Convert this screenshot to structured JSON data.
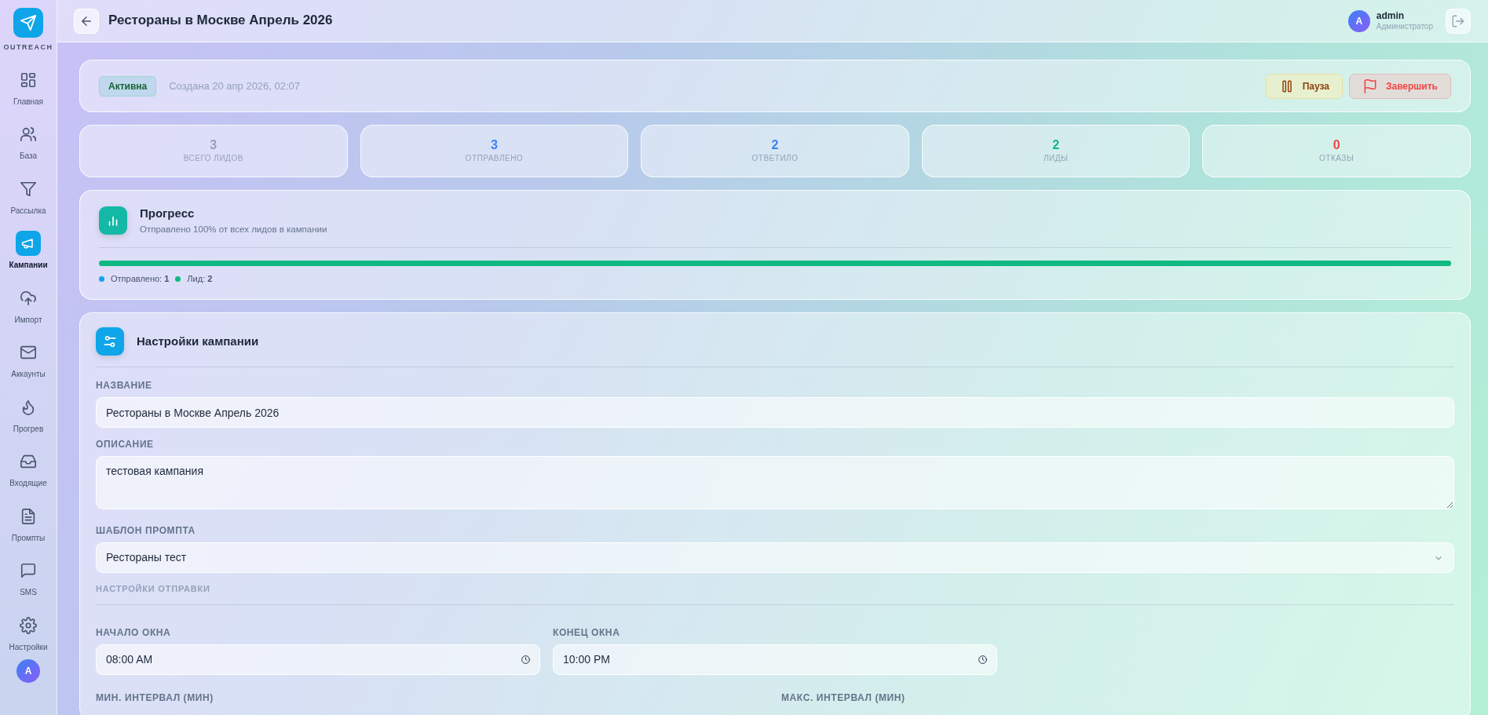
{
  "sidebar": {
    "logo": "OUTREACH",
    "items": [
      {
        "label": "Главная",
        "selected": false
      },
      {
        "label": "База",
        "selected": false
      },
      {
        "label": "Рассылка",
        "selected": false
      },
      {
        "label": "Кампании",
        "selected": true
      },
      {
        "label": "Импорт",
        "selected": false
      },
      {
        "label": "Аккаунты",
        "selected": false
      },
      {
        "label": "Прогрев",
        "selected": false
      },
      {
        "label": "Входящие",
        "selected": false
      },
      {
        "label": "Промпты",
        "selected": false
      },
      {
        "label": "SMS",
        "selected": false
      },
      {
        "label": "Настройки",
        "selected": false
      }
    ],
    "avatar": "A"
  },
  "header": {
    "title": "Рестораны в Москве Апрель 2026",
    "user": {
      "initial": "A",
      "name": "admin",
      "role": "Администратор"
    }
  },
  "status": {
    "badge": "Активна",
    "created": "Создана 20 апр 2026, 02:07",
    "buttons": [
      {
        "kind": "pause",
        "label": "Пауза"
      },
      {
        "kind": "finish",
        "label": "Завершить"
      }
    ]
  },
  "stats": [
    {
      "value": "3",
      "label": "ВСЕГО ЛИДОВ",
      "color": "#94a3b8"
    },
    {
      "value": "3",
      "label": "ОТПРАВЛЕНО",
      "color": "#3b82f6"
    },
    {
      "value": "2",
      "label": "ОТВЕТИЛО",
      "color": "#3b82f6"
    },
    {
      "value": "2",
      "label": "ЛИДЫ",
      "color": "#10b981"
    },
    {
      "value": "0",
      "label": "ОТКАЗЫ",
      "color": "#ef4444"
    }
  ],
  "progress": {
    "title": "Прогресс",
    "subtitle": "Отправлено 100% от всех лидов в кампании",
    "level": 1,
    "legend": [
      {
        "label": "Отправлено:",
        "value": "1",
        "color": "#0ea5e9"
      },
      {
        "label": "Лид:",
        "value": "2",
        "color": "#10b981"
      }
    ]
  },
  "settings": {
    "title": "Настройки кампании",
    "fields": [
      {
        "kind": "input",
        "label": "НАЗВАНИЕ",
        "value": "Рестораны в Москве Апрель 2026"
      },
      {
        "kind": "textarea",
        "label": "ОПИСАНИЕ",
        "value": "тестовая кампания"
      },
      {
        "kind": "select",
        "label": "ШАБЛОН ПРОМПТА",
        "value": "Рестораны тест"
      }
    ],
    "section": "НАСТРОЙКИ ОТПРАВКИ",
    "time_fields": [
      {
        "label": "НАЧАЛО ОКНА",
        "value": "08:00 AM"
      },
      {
        "label": "КОНЕЦ ОКНА",
        "value": "10:00 PM"
      }
    ],
    "interval_labels": [
      "МИН. ИНТЕРВАЛ (МИН)",
      "МАКС. ИНТЕРВАЛ (МИН)"
    ]
  }
}
